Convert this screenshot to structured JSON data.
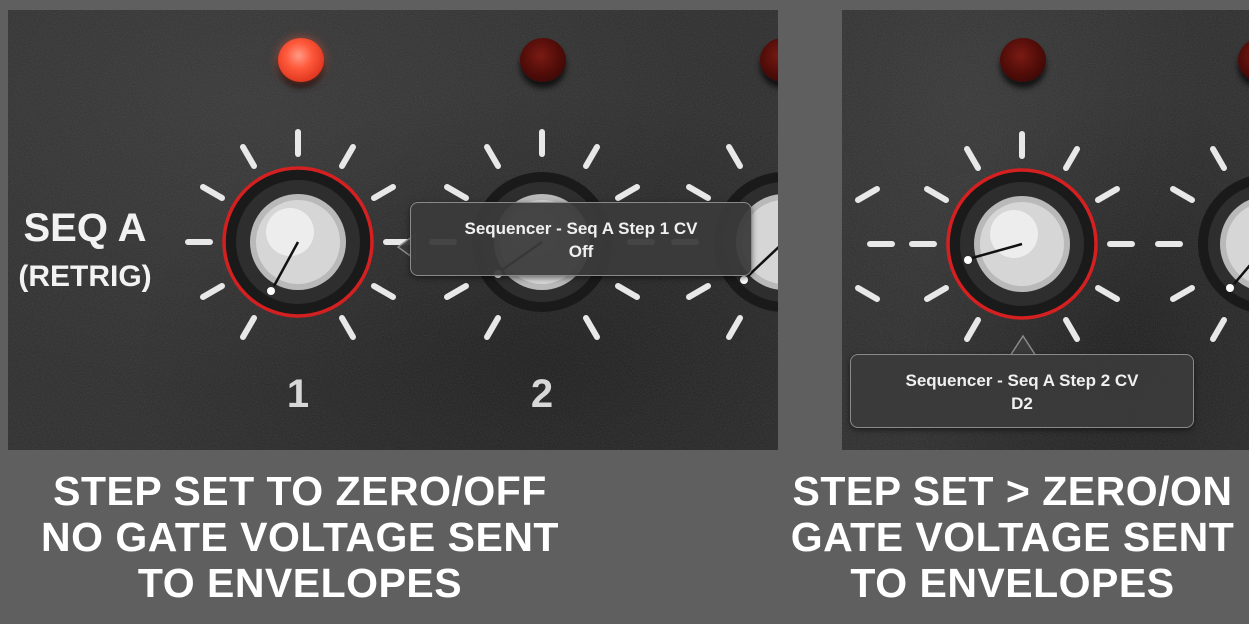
{
  "left_panel": {
    "row_label_line1": "SEQ A",
    "row_label_line2": "(RETRIG)",
    "step_numbers": [
      "1",
      "2"
    ],
    "tooltip": {
      "title": "Sequencer - Seq A Step 1 CV",
      "value": "Off"
    },
    "leds": [
      "on",
      "off",
      "off"
    ]
  },
  "right_panel": {
    "tooltip": {
      "title": "Sequencer - Seq A Step 2 CV",
      "value": "D2"
    },
    "leds": [
      "off",
      "off"
    ]
  },
  "captions": {
    "left": [
      "STEP SET TO ZERO/OFF",
      "NO GATE VOLTAGE SENT",
      "TO ENVELOPES"
    ],
    "right": [
      "STEP SET > ZERO/ON",
      "GATE VOLTAGE SENT",
      "TO ENVELOPES"
    ]
  },
  "colors": {
    "frame": "#5f5f5f",
    "led_on": "#ff5a3c",
    "led_off": "#4e0c08",
    "selected_ring": "#d42020"
  }
}
